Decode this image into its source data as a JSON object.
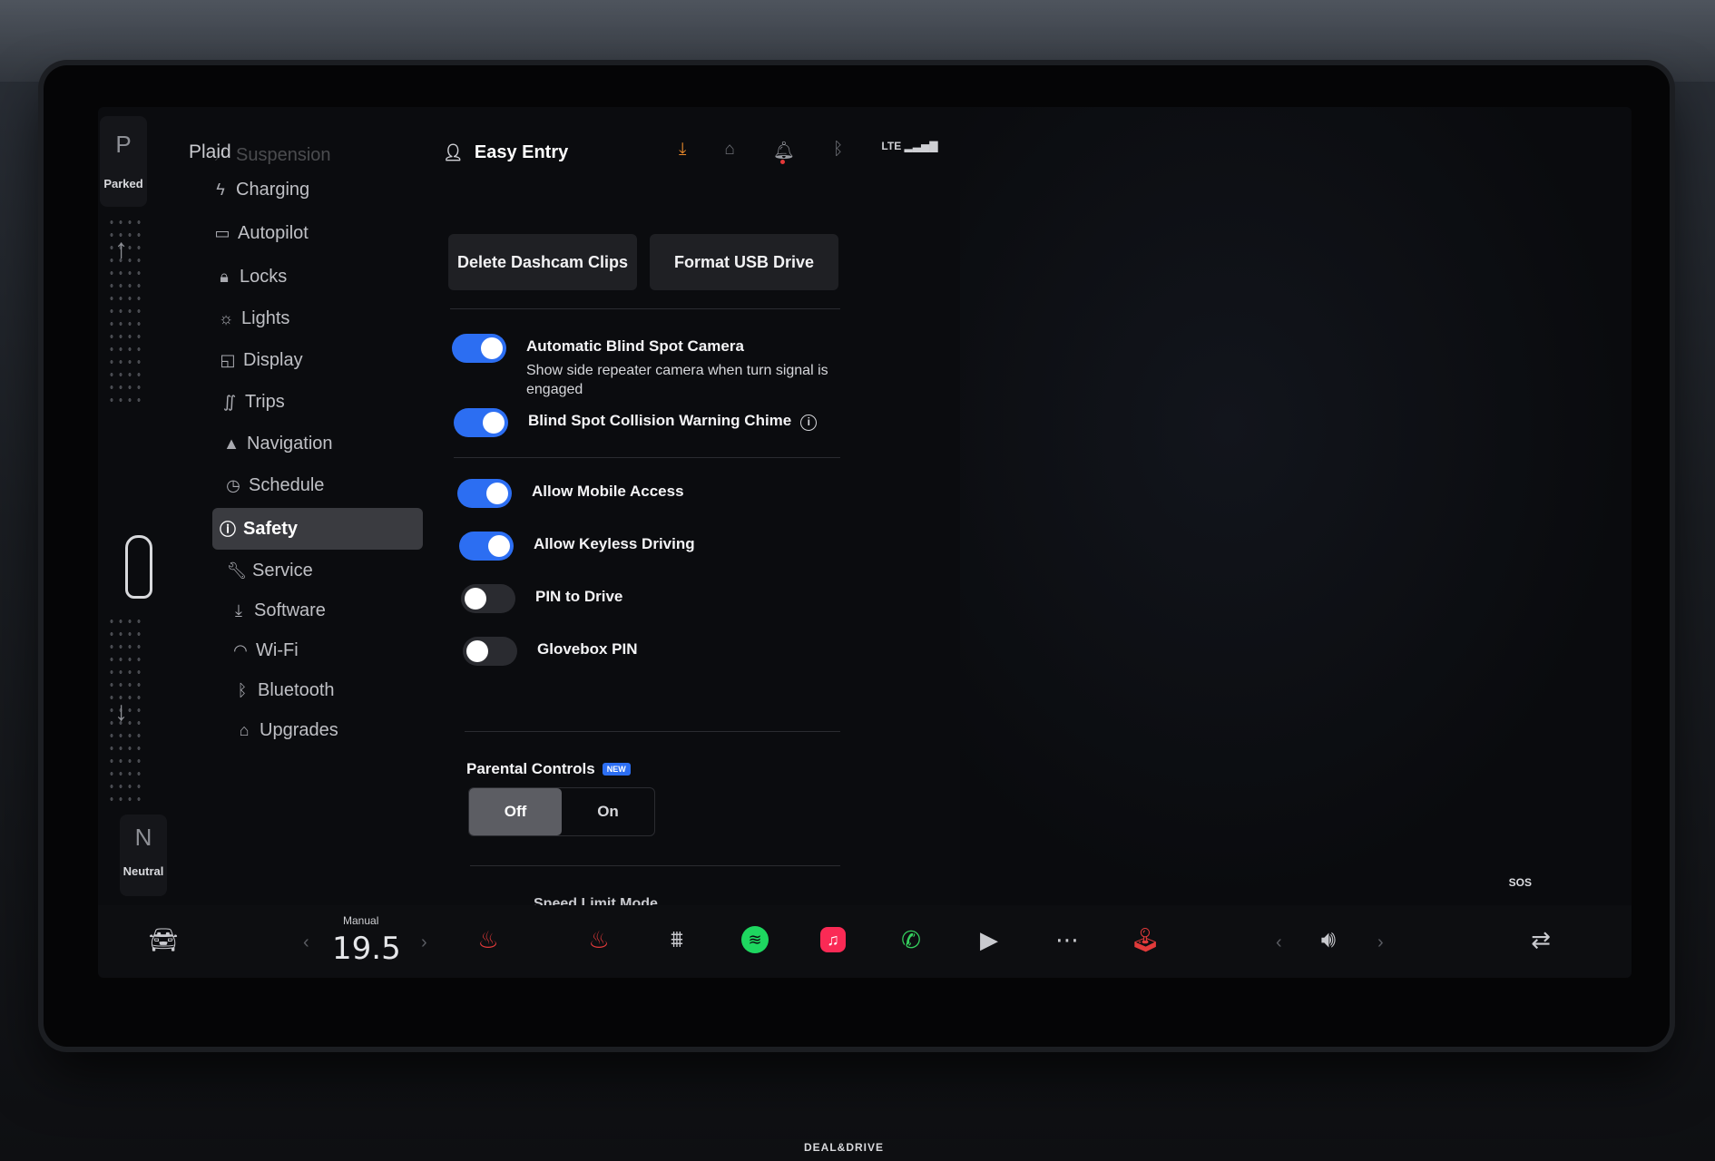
{
  "gear": {
    "top_letter": "P",
    "top_label": "Parked",
    "bottom_letter": "N",
    "bottom_label": "Neutral"
  },
  "sidebar": {
    "brand": "Plaid",
    "items": [
      {
        "label": "Suspension",
        "icon": "suspension-icon"
      },
      {
        "label": "Charging",
        "icon": "lightning-icon"
      },
      {
        "label": "Autopilot",
        "icon": "steering-wheel-icon"
      },
      {
        "label": "Locks",
        "icon": "lock-icon"
      },
      {
        "label": "Lights",
        "icon": "light-icon"
      },
      {
        "label": "Display",
        "icon": "display-icon"
      },
      {
        "label": "Trips",
        "icon": "trips-icon"
      },
      {
        "label": "Navigation",
        "icon": "navigation-icon"
      },
      {
        "label": "Schedule",
        "icon": "clock-icon"
      },
      {
        "label": "Safety",
        "icon": "safety-icon",
        "active": true
      },
      {
        "label": "Service",
        "icon": "wrench-icon"
      },
      {
        "label": "Software",
        "icon": "download-icon"
      },
      {
        "label": "Wi-Fi",
        "icon": "wifi-icon"
      },
      {
        "label": "Bluetooth",
        "icon": "bluetooth-icon"
      },
      {
        "label": "Upgrades",
        "icon": "bag-icon"
      }
    ]
  },
  "topbar": {
    "profile": "Easy Entry",
    "lte": "LTE"
  },
  "buttons": {
    "delete_dashcam": "Delete Dashcam Clips",
    "format_usb": "Format USB Drive"
  },
  "settings": {
    "blind_spot_camera": {
      "title": "Automatic Blind Spot Camera",
      "desc": "Show side repeater camera when turn signal is engaged",
      "on": true
    },
    "collision_chime": {
      "title": "Blind Spot Collision Warning Chime",
      "on": true
    },
    "mobile_access": {
      "title": "Allow Mobile Access",
      "on": true
    },
    "keyless_driving": {
      "title": "Allow Keyless Driving",
      "on": true
    },
    "pin_to_drive": {
      "title": "PIN to Drive",
      "on": false
    },
    "glovebox_pin": {
      "title": "Glovebox PIN",
      "on": false
    },
    "speed_limit_mode": {
      "title": "Speed Limit Mode"
    }
  },
  "parental_controls": {
    "label": "Parental Controls",
    "badge": "NEW",
    "options": [
      "Off",
      "On"
    ],
    "selected": "Off"
  },
  "sos": "SOS",
  "dock": {
    "temp_mode": "Manual",
    "temperature": "19.5"
  },
  "watermark": "DEAL&DRIVE"
}
